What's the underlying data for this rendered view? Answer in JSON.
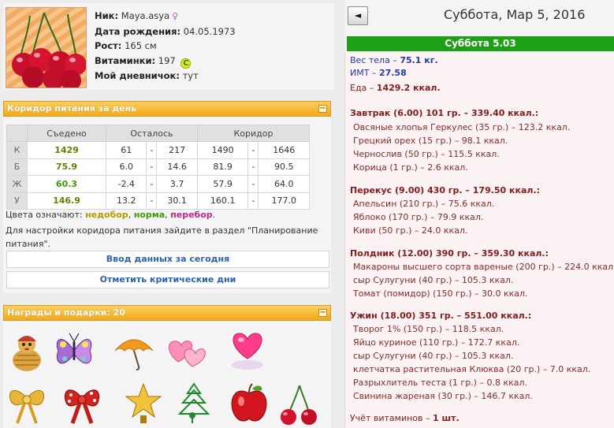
{
  "profile": {
    "nick_label": "Ник:",
    "nick": "Maya.asya",
    "birth_label": "Дата рождения:",
    "birth": "04.05.1973",
    "height_label": "Рост:",
    "height": "165 см",
    "vitamins_label": "Витаминки:",
    "vitamins": "197",
    "vitamin_badge": "C",
    "diary_label": "Мой дневничок:",
    "diary": "тут"
  },
  "corridor": {
    "title": "Коридор питания за день",
    "headers": [
      "",
      "Съедено",
      "Осталось",
      "Коридор"
    ],
    "rows": [
      {
        "label": "К",
        "eaten": "1429",
        "rem_min": "61",
        "rem_max": "217",
        "cor_min": "1490",
        "cor_max": "1646"
      },
      {
        "label": "Б",
        "eaten": "75.9",
        "rem_min": "6.0",
        "rem_max": "14.6",
        "cor_min": "81.9",
        "cor_max": "90.5"
      },
      {
        "label": "Ж",
        "eaten": "60.3",
        "rem_min": "-2.4",
        "rem_max": "3.7",
        "cor_min": "57.9",
        "cor_max": "64.0"
      },
      {
        "label": "У",
        "eaten": "146.9",
        "rem_min": "13.2",
        "rem_max": "30.1",
        "cor_min": "160.1",
        "cor_max": "177.0"
      }
    ],
    "dash": "-",
    "legend_prefix": "Цвета означают:",
    "legend_under": "недобор",
    "legend_norm": "норма",
    "legend_over": "перебор",
    "legend_comma": ",",
    "legend_dot": ".",
    "settings_note": "Для настройки коридора питания зайдите в раздел \"Планирование питания\".",
    "btn_today": "Ввод данных за сегодня",
    "btn_critical": "Отметить критические дни"
  },
  "awards": {
    "title": "Награды и подарки: 20"
  },
  "day": {
    "prev_arrow": "◄",
    "date_title": "Суббота, Мар 5, 2016",
    "bar": "Суббота 5.03",
    "weight_label": "Вес тела –",
    "weight": "75.1 кг.",
    "bmi_label": "ИМТ –",
    "bmi": "27.58",
    "food_label": "Еда –",
    "food": "1429.2 ккал.",
    "vitamins_label": "Учёт витаминов –",
    "vitamins": "1 шт."
  },
  "meals": [
    {
      "title": "Завтрак (6.00) 101 гр. – 339.40 ккал.:",
      "items": [
        "Овсяные хлопья Геркулес (35 гр.) – 123.2 ккал.",
        "Грецкий орех (15 гр.) – 98.1 ккал.",
        "Чернослив (50 гр.) – 115.5 ккал.",
        "Корица (1 гр.) – 2.6 ккал."
      ]
    },
    {
      "title": "Перекус (9.00) 430 гр. – 179.50 ккал.:",
      "items": [
        "Апельсин (210 гр.) – 75.6 ккал.",
        "Яблоко (170 гр.) – 79.9 ккал.",
        "Киви (50 гр.) – 24.0 ккал."
      ]
    },
    {
      "title": "Полдник (12.00) 390 гр. – 359.30 ккал.:",
      "items": [
        "Макароны высшего сорта вареные (200 гр.) – 224.0 ккал.",
        "сыр Сулугуни (40 гр.) – 105.3 ккал.",
        "Томат (помидор) (150 гр.) – 30.0 ккал."
      ]
    },
    {
      "title": "Ужин (18.00) 351 гр. – 551.00 ккал.:",
      "items": [
        "Творог 1% (150 гр.) – 118.5 ккал.",
        "Яйцо куриное (110 гр.) – 172.7 ккал.",
        "сыр Сулугуни (40 гр.) – 105.3 ккал.",
        "клетчатка растительная Клюква (20 гр.) – 7.0 ккал.",
        "Разрыхлитель теста (1 гр.) – 0.8 ккал.",
        "Свинина жареная (30 гр.) – 146.7 ккал."
      ]
    }
  ]
}
